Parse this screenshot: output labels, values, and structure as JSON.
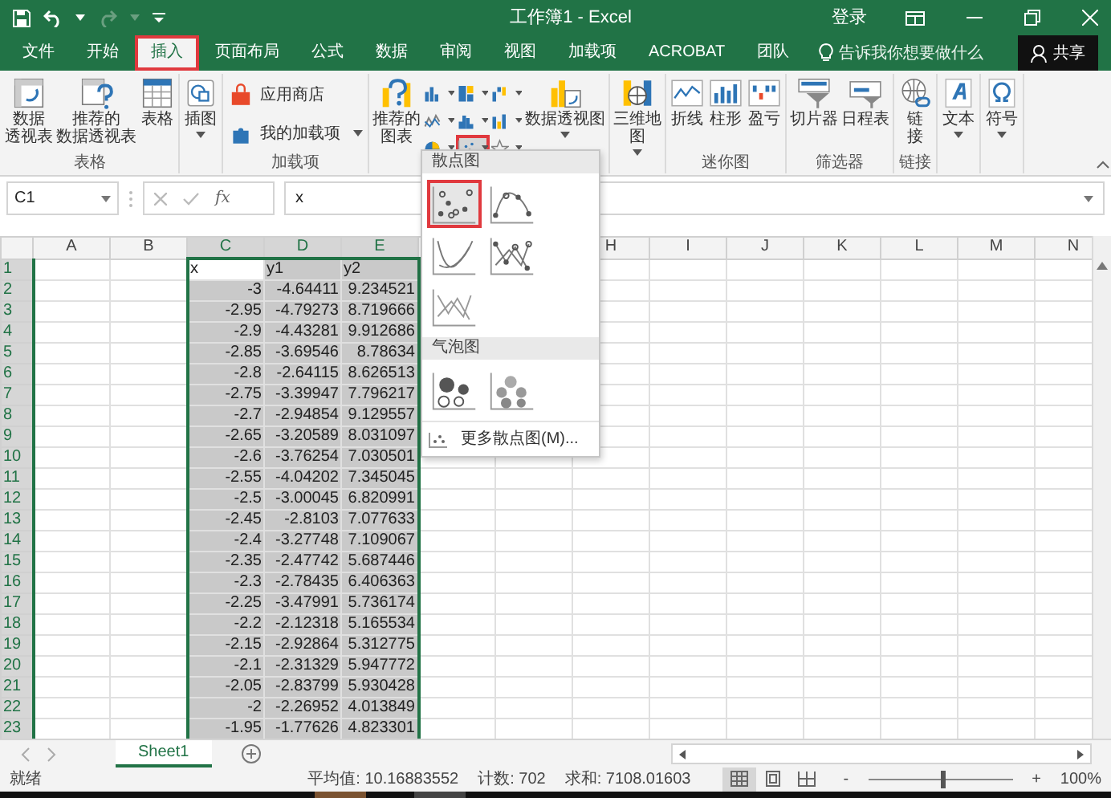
{
  "title_bar": {
    "title": "工作簿1 - Excel",
    "sign_in": "登录",
    "redo_disabled": true
  },
  "tabs": [
    {
      "label": "文件",
      "selected": false,
      "highlighted": false
    },
    {
      "label": "开始",
      "selected": false,
      "highlighted": false
    },
    {
      "label": "插入",
      "selected": true,
      "highlighted": true
    },
    {
      "label": "页面布局",
      "selected": false,
      "highlighted": false
    },
    {
      "label": "公式",
      "selected": false,
      "highlighted": false
    },
    {
      "label": "数据",
      "selected": false,
      "highlighted": false
    },
    {
      "label": "审阅",
      "selected": false,
      "highlighted": false
    },
    {
      "label": "视图",
      "selected": false,
      "highlighted": false
    },
    {
      "label": "加载项",
      "selected": false,
      "highlighted": false
    },
    {
      "label": "ACROBAT",
      "selected": false,
      "highlighted": false
    },
    {
      "label": "团队",
      "selected": false,
      "highlighted": false
    }
  ],
  "tell_me": "告诉我你想要做什么",
  "share": "共享",
  "ribbon": [
    {
      "label": "表格",
      "items": [
        {
          "kind": "large",
          "lines": [
            "数据",
            "透视表"
          ],
          "menu": false
        },
        {
          "kind": "large",
          "lines": [
            "推荐的",
            "数据透视表"
          ],
          "menu": false
        },
        {
          "kind": "large",
          "lines": [
            "表格"
          ],
          "menu": false
        }
      ]
    },
    {
      "items": [
        {
          "kind": "large",
          "lines": [
            "插图"
          ],
          "menu": true
        }
      ]
    },
    {
      "label": "加载项",
      "items": [
        {
          "kind": "row",
          "lines": [
            "应用商店"
          ],
          "menu": false
        },
        {
          "kind": "row",
          "lines": [
            "我的加载项"
          ],
          "menu": true
        }
      ]
    },
    {
      "items": [
        {
          "kind": "large",
          "lines": [
            "推荐的",
            "图表"
          ],
          "menu": false
        },
        {
          "kind": "grid",
          "buttons": [
            {
              "highlighted": false
            },
            {
              "highlighted": false
            },
            {
              "highlighted": false
            },
            {
              "highlighted": false
            },
            {
              "highlighted": false
            },
            {
              "highlighted": false
            },
            {
              "highlighted": false
            },
            {
              "highlighted": true
            },
            {
              "highlighted": false
            }
          ]
        },
        {
          "kind": "large",
          "lines": [
            "数据透视图"
          ],
          "menu": true
        }
      ]
    },
    {
      "items": [
        {
          "kind": "large",
          "lines": [
            "三维地",
            "图"
          ],
          "menu": true
        }
      ]
    },
    {
      "label": "迷你图",
      "items": [
        {
          "kind": "large",
          "lines": [
            "折线"
          ],
          "menu": false
        },
        {
          "kind": "large",
          "lines": [
            "柱形"
          ],
          "menu": false
        },
        {
          "kind": "large",
          "lines": [
            "盈亏"
          ],
          "menu": false
        }
      ]
    },
    {
      "label": "筛选器",
      "items": [
        {
          "kind": "large",
          "lines": [
            "切片器"
          ],
          "menu": false
        },
        {
          "kind": "large",
          "lines": [
            "日程表"
          ],
          "menu": false
        }
      ]
    },
    {
      "label": "链接",
      "items": [
        {
          "kind": "large",
          "lines": [
            "链",
            "接"
          ],
          "menu": false
        }
      ]
    },
    {
      "items": [
        {
          "kind": "large",
          "lines": [
            "文本"
          ],
          "menu": true
        }
      ]
    },
    {
      "items": [
        {
          "kind": "large",
          "lines": [
            "符号"
          ],
          "menu": true
        }
      ]
    }
  ],
  "formula_bar": {
    "name_box": "C1",
    "function_label": "fx",
    "formula": "x"
  },
  "sheet": {
    "columns": [
      {
        "label": "A",
        "selected": false
      },
      {
        "label": "B",
        "selected": false
      },
      {
        "label": "C",
        "selected": true
      },
      {
        "label": "D",
        "selected": true
      },
      {
        "label": "E",
        "selected": true
      },
      {
        "label": "H",
        "selected": false
      },
      {
        "label": "I",
        "selected": false
      },
      {
        "label": "J",
        "selected": false
      },
      {
        "label": "K",
        "selected": false
      },
      {
        "label": "L",
        "selected": false
      },
      {
        "label": "M",
        "selected": false
      },
      {
        "label": "N",
        "selected": false
      }
    ],
    "rows": [
      {
        "number": "1",
        "selected": true,
        "active": true,
        "kind": "text",
        "cells": [
          "",
          "",
          "x",
          "y1",
          "y2"
        ]
      },
      {
        "number": "2",
        "selected": true,
        "active": false,
        "kind": "number",
        "cells": [
          "",
          "",
          "-3",
          "-4.64411",
          "9.234521"
        ]
      },
      {
        "number": "3",
        "selected": true,
        "active": false,
        "kind": "number",
        "cells": [
          "",
          "",
          "-2.95",
          "-4.79273",
          "8.719666"
        ]
      },
      {
        "number": "4",
        "selected": true,
        "active": false,
        "kind": "number",
        "cells": [
          "",
          "",
          "-2.9",
          "-4.43281",
          "9.912686"
        ]
      },
      {
        "number": "5",
        "selected": true,
        "active": false,
        "kind": "number",
        "cells": [
          "",
          "",
          "-2.85",
          "-3.69546",
          "8.78634"
        ]
      },
      {
        "number": "6",
        "selected": true,
        "active": false,
        "kind": "number",
        "cells": [
          "",
          "",
          "-2.8",
          "-2.64115",
          "8.626513"
        ]
      },
      {
        "number": "7",
        "selected": true,
        "active": false,
        "kind": "number",
        "cells": [
          "",
          "",
          "-2.75",
          "-3.39947",
          "7.796217"
        ]
      },
      {
        "number": "8",
        "selected": true,
        "active": false,
        "kind": "number",
        "cells": [
          "",
          "",
          "-2.7",
          "-2.94854",
          "9.129557"
        ]
      },
      {
        "number": "9",
        "selected": true,
        "active": false,
        "kind": "number",
        "cells": [
          "",
          "",
          "-2.65",
          "-3.20589",
          "8.031097"
        ]
      },
      {
        "number": "10",
        "selected": true,
        "active": false,
        "kind": "number",
        "cells": [
          "",
          "",
          "-2.6",
          "-3.76254",
          "7.030501"
        ]
      },
      {
        "number": "11",
        "selected": true,
        "active": false,
        "kind": "number",
        "cells": [
          "",
          "",
          "-2.55",
          "-4.04202",
          "7.345045"
        ]
      },
      {
        "number": "12",
        "selected": true,
        "active": false,
        "kind": "number",
        "cells": [
          "",
          "",
          "-2.5",
          "-3.00045",
          "6.820991"
        ]
      },
      {
        "number": "13",
        "selected": true,
        "active": false,
        "kind": "number",
        "cells": [
          "",
          "",
          "-2.45",
          "-2.8103",
          "7.077633"
        ]
      },
      {
        "number": "14",
        "selected": true,
        "active": false,
        "kind": "number",
        "cells": [
          "",
          "",
          "-2.4",
          "-3.27748",
          "7.109067"
        ]
      },
      {
        "number": "15",
        "selected": true,
        "active": false,
        "kind": "number",
        "cells": [
          "",
          "",
          "-2.35",
          "-2.47742",
          "5.687446"
        ]
      },
      {
        "number": "16",
        "selected": true,
        "active": false,
        "kind": "number",
        "cells": [
          "",
          "",
          "-2.3",
          "-2.78435",
          "6.406363"
        ]
      },
      {
        "number": "17",
        "selected": true,
        "active": false,
        "kind": "number",
        "cells": [
          "",
          "",
          "-2.25",
          "-3.47991",
          "5.736174"
        ]
      },
      {
        "number": "18",
        "selected": true,
        "active": false,
        "kind": "number",
        "cells": [
          "",
          "",
          "-2.2",
          "-2.12318",
          "5.165534"
        ]
      },
      {
        "number": "19",
        "selected": true,
        "active": false,
        "kind": "number",
        "cells": [
          "",
          "",
          "-2.15",
          "-2.92864",
          "5.312775"
        ]
      },
      {
        "number": "20",
        "selected": true,
        "active": false,
        "kind": "number",
        "cells": [
          "",
          "",
          "-2.1",
          "-2.31329",
          "5.947772"
        ]
      },
      {
        "number": "21",
        "selected": true,
        "active": false,
        "kind": "number",
        "cells": [
          "",
          "",
          "-2.05",
          "-2.83799",
          "5.930428"
        ]
      },
      {
        "number": "22",
        "selected": true,
        "active": false,
        "kind": "number",
        "cells": [
          "",
          "",
          "-2",
          "-2.26952",
          "4.013849"
        ]
      },
      {
        "number": "23",
        "selected": true,
        "active": false,
        "kind": "number",
        "cells": [
          "",
          "",
          "-1.95",
          "-1.77626",
          "4.823301"
        ]
      }
    ]
  },
  "scatter_menu": {
    "sections": [
      {
        "title": "散点图",
        "options": [
          {
            "kind": "markers",
            "selected": true
          },
          {
            "kind": "smooth-markers",
            "selected": false
          },
          {
            "kind": "smooth",
            "selected": false
          },
          {
            "kind": "straight-markers",
            "selected": false
          },
          {
            "kind": "straight",
            "selected": false
          }
        ]
      },
      {
        "title": "气泡图",
        "options": [
          {
            "kind": "bubble",
            "selected": false
          },
          {
            "kind": "bubble-3d",
            "selected": false
          }
        ]
      }
    ],
    "more": "更多散点图(M)..."
  },
  "sheet_tabs": [
    {
      "label": "Sheet1",
      "selected": true
    }
  ],
  "status_bar": {
    "ready": "就绪",
    "stats": [
      "平均值: 10.16883552",
      "计数: 702",
      "求和: 7108.01603"
    ],
    "views": [
      {
        "kind": "normal",
        "selected": true
      },
      {
        "kind": "page-layout",
        "selected": false
      },
      {
        "kind": "page-break",
        "selected": false
      }
    ],
    "zoom_out": "-",
    "zoom_in": "+",
    "zoom": {
      "level": 0.5,
      "reading": "100%"
    }
  }
}
